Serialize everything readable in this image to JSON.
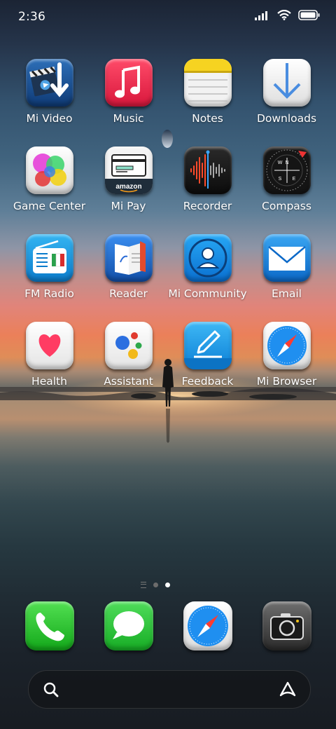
{
  "status_bar": {
    "time": "2:36"
  },
  "apps": [
    {
      "name": "mi-video",
      "label": "Mi Video",
      "icon": "video-clapper-download-icon"
    },
    {
      "name": "music",
      "label": "Music",
      "icon": "music-note-icon"
    },
    {
      "name": "notes",
      "label": "Notes",
      "icon": "notepad-icon"
    },
    {
      "name": "downloads",
      "label": "Downloads",
      "icon": "download-arrow-icon"
    },
    {
      "name": "game-center",
      "label": "Game Center",
      "icon": "color-circles-icon"
    },
    {
      "name": "mi-pay",
      "label": "Mi Pay",
      "icon": "wallet-card-icon",
      "icon_text": "amazon"
    },
    {
      "name": "recorder",
      "label": "Recorder",
      "icon": "waveform-icon"
    },
    {
      "name": "compass",
      "label": "Compass",
      "icon": "compass-icon",
      "icon_letters": [
        "N",
        "E",
        "S",
        "W"
      ]
    },
    {
      "name": "fm-radio",
      "label": "FM Radio",
      "icon": "radio-icon"
    },
    {
      "name": "reader",
      "label": "Reader",
      "icon": "book-icon"
    },
    {
      "name": "mi-community",
      "label": "Mi Community",
      "icon": "person-circle-icon"
    },
    {
      "name": "email",
      "label": "Email",
      "icon": "envelope-icon"
    },
    {
      "name": "health",
      "label": "Health",
      "icon": "heart-icon"
    },
    {
      "name": "assistant",
      "label": "Assistant",
      "icon": "assistant-dots-icon"
    },
    {
      "name": "feedback",
      "label": "Feedback",
      "icon": "pencil-icon"
    },
    {
      "name": "mi-browser",
      "label": "Mi Browser",
      "icon": "safari-compass-icon"
    }
  ],
  "dock": [
    {
      "name": "phone",
      "icon": "phone-icon"
    },
    {
      "name": "messages",
      "icon": "speech-bubble-icon"
    },
    {
      "name": "browser",
      "icon": "safari-compass-icon"
    },
    {
      "name": "camera",
      "icon": "camera-icon"
    }
  ],
  "page_indicator": {
    "current_page": 2,
    "total_pages": 2
  }
}
